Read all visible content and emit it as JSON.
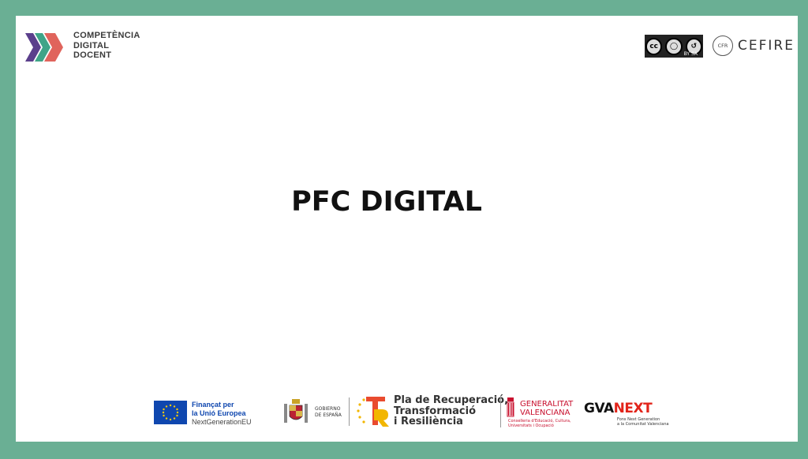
{
  "header": {
    "logo_lines": [
      "COMPETÈNCIA",
      "DIGITAL",
      "DOCENT"
    ],
    "cc_license": {
      "symbols": [
        "cc",
        "BY",
        "SA"
      ],
      "sub": "BY   SA"
    },
    "cefire": {
      "badge": "CFR",
      "name": "CEFIRE"
    }
  },
  "main": {
    "title": "PFC DIGITAL"
  },
  "footer": {
    "eu": {
      "line1": "Finançat per",
      "line2": "la Unió Europea",
      "line3": "NextGenerationEU"
    },
    "gobierno": {
      "line1": "GOBIERNO",
      "line2": "DE ESPAÑA"
    },
    "prtr": {
      "line1": "Pla de Recuperació,",
      "line2": "Transformació",
      "line3": "i Resiliència"
    },
    "generalitat": {
      "line1": "GENERALITAT",
      "line2": "VALENCIANA",
      "sub1": "Conselleria d'Educació, Cultura,",
      "sub2": "Universitats i Ocupació"
    },
    "gvanext": {
      "gva": "GVA",
      "next": "NEXT",
      "sub1": "Fons Next Generation",
      "sub2": "a la Comunitat Valenciana"
    }
  },
  "colors": {
    "frame": "#6aaf94",
    "eu_blue": "#0f47af",
    "gv_red": "#c8102e",
    "next_red": "#e2241a"
  }
}
